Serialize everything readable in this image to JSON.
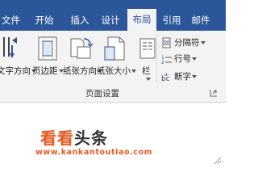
{
  "tabs": [
    {
      "label": "文件",
      "active": false
    },
    {
      "label": "开始",
      "active": false
    },
    {
      "label": "插入",
      "active": false
    },
    {
      "label": "设计",
      "active": false
    },
    {
      "label": "布局",
      "active": true
    },
    {
      "label": "引用",
      "active": false
    },
    {
      "label": "邮件",
      "active": false
    }
  ],
  "ribbon": {
    "buttons": {
      "text_direction": "文字方向",
      "margins": "页边距",
      "orientation": "纸张方向",
      "size": "纸张大小",
      "columns": "栏"
    },
    "small": {
      "breaks": "分隔符",
      "line_numbers": "行号",
      "hyphenation": "断字"
    },
    "group_label": "页面设置"
  },
  "watermark": {
    "main_part1": "看看",
    "main_part2": "头条",
    "url": "www.kankantoutiao.com"
  },
  "colors": {
    "ribbon_tab_bar": "#2b579a",
    "ribbon_body": "#f3f3f3",
    "logo_accent": "#e8591d"
  }
}
